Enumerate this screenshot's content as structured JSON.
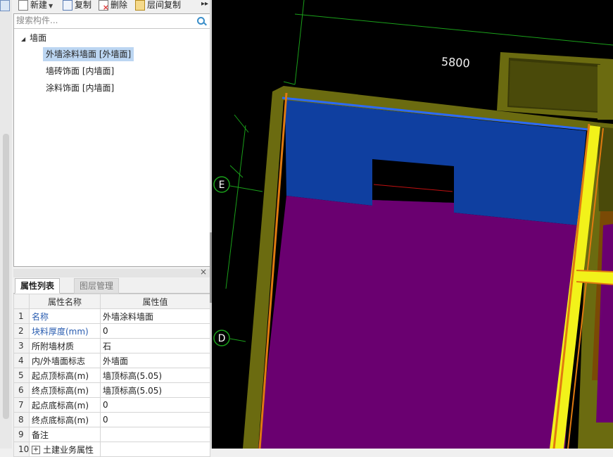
{
  "toolbar": {
    "new_label": "新建",
    "copy_label": "复制",
    "delete_label": "删除",
    "layer_copy_label": "层间复制",
    "more_glyph": "▸▸"
  },
  "search": {
    "placeholder": "搜索构件..."
  },
  "tree": {
    "root_label": "墙面",
    "items": [
      {
        "label": "外墙涂料墙面 [外墙面]",
        "selected": true
      },
      {
        "label": "墙砖饰面 [内墙面]",
        "selected": false
      },
      {
        "label": "涂料饰面 [内墙面]",
        "selected": false
      }
    ]
  },
  "props_panel": {
    "close_glyph": "×",
    "tabs": [
      {
        "label": "属性列表",
        "active": true
      },
      {
        "label": "图层管理",
        "active": false
      }
    ],
    "columns": [
      "属性名称",
      "属性值"
    ],
    "rows": [
      {
        "num": "1",
        "name": "名称",
        "value": "外墙涂料墙面",
        "blue": true
      },
      {
        "num": "2",
        "name": "块料厚度(mm)",
        "value": "0",
        "blue": true
      },
      {
        "num": "3",
        "name": "所附墙材质",
        "value": "石",
        "blue": false
      },
      {
        "num": "4",
        "name": "内/外墙面标志",
        "value": "外墙面",
        "blue": false
      },
      {
        "num": "5",
        "name": "起点顶标高(m)",
        "value": "墙顶标高(5.05)",
        "blue": false
      },
      {
        "num": "6",
        "name": "终点顶标高(m)",
        "value": "墙顶标高(5.05)",
        "blue": false
      },
      {
        "num": "7",
        "name": "起点底标高(m)",
        "value": "0",
        "blue": false
      },
      {
        "num": "8",
        "name": "终点底标高(m)",
        "value": "0",
        "blue": false
      },
      {
        "num": "9",
        "name": "备注",
        "value": "",
        "blue": false
      },
      {
        "num": "10",
        "name": "土建业务属性",
        "value": "",
        "blue": false,
        "expander": "+"
      }
    ]
  },
  "viewport": {
    "dimension_label": "5800",
    "axis_labels": [
      "E",
      "D"
    ],
    "colors": {
      "background": "#000000",
      "wall_olive": "#6b6b10",
      "face_blue": "#0f3fa0",
      "face_purple": "#6a0070",
      "column_yellow": "#f2f21a",
      "edge_orange": "#e07a10",
      "dimension_green": "#1aa01a"
    }
  }
}
